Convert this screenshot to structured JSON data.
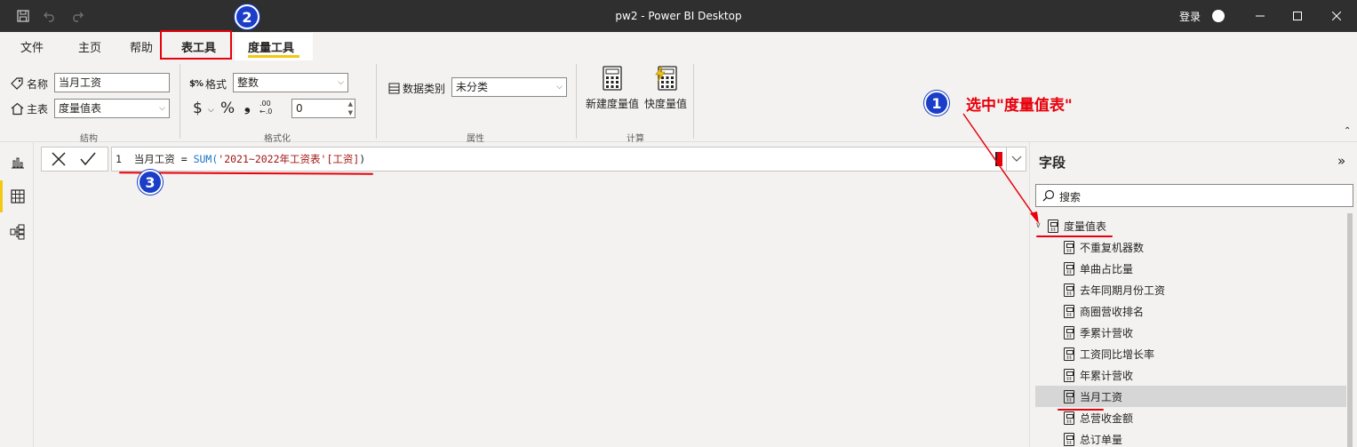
{
  "window": {
    "title": "pw2 - Power BI Desktop",
    "login": "登录"
  },
  "tabs": [
    "文件",
    "主页",
    "帮助",
    "表工具",
    "度量工具"
  ],
  "ribbon": {
    "structure": {
      "name_label": "名称",
      "name_value": "当月工资",
      "home_label": "主表",
      "home_value": "度量值表",
      "group_label": "结构"
    },
    "formatting": {
      "format_label": "格式",
      "format_value": "整数",
      "currency": "$",
      "percent": "%",
      "comma": "❟",
      "decimal_value": "0",
      "group_label": "格式化"
    },
    "properties": {
      "category_label": "数据类别",
      "category_value": "未分类",
      "group_label": "属性"
    },
    "calculations": {
      "new_measure": "新建度量值",
      "quick_measure": "快度量值",
      "group_label": "计算"
    }
  },
  "formula": {
    "line_no": "1",
    "name": "当月工资",
    "op": " = ",
    "func": "SUM(",
    "arg": "'2021~2022年工资表'[工资]",
    "close": ")"
  },
  "fields_pane": {
    "title": "字段",
    "search_placeholder": "搜索",
    "table_name": "度量值表",
    "items": [
      "不重复机器数",
      "单曲占比量",
      "去年同期月份工资",
      "商圈营收排名",
      "季累计营收",
      "工资同比增长率",
      "年累计营收",
      "当月工资",
      "总营收金额",
      "总订单量"
    ],
    "selected_index": 7
  },
  "annotations": {
    "step1": "1",
    "step2": "2",
    "step3": "3",
    "note1": "选中\"度量值表\""
  },
  "colors": {
    "accent": "#f2c811",
    "annotation_red": "#e8000b",
    "annotation_blue": "#1a3ec8",
    "titlebar": "#2f2f2f"
  }
}
